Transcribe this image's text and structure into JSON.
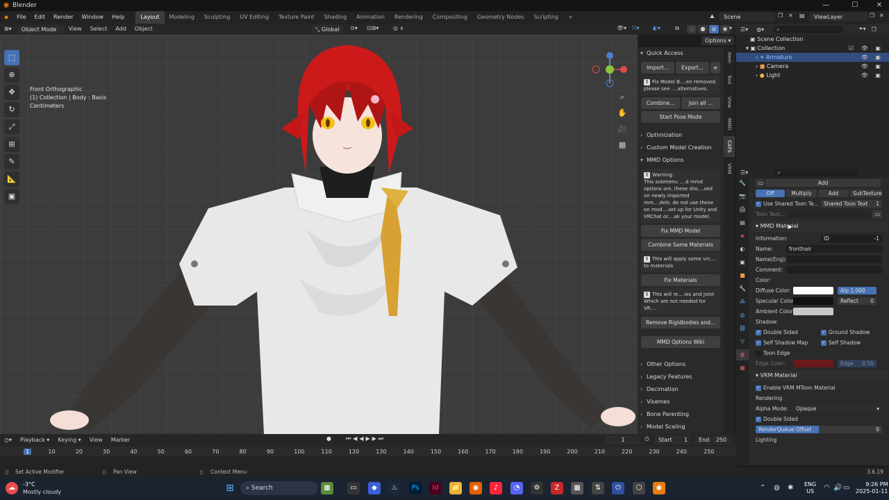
{
  "window": {
    "title": "Blender",
    "controls": [
      "—",
      "☐",
      "✕"
    ]
  },
  "menu": [
    "File",
    "Edit",
    "Render",
    "Window",
    "Help"
  ],
  "workspaces": [
    "Layout",
    "Modeling",
    "Sculpting",
    "UV Editing",
    "Texture Paint",
    "Shading",
    "Animation",
    "Rendering",
    "Compositing",
    "Geometry Nodes",
    "Scripting",
    "+"
  ],
  "scene": {
    "scene_name": "Scene",
    "view_layer": "ViewLayer"
  },
  "viewport_header": {
    "mode": "Object Mode",
    "menus": [
      "View",
      "Select",
      "Add",
      "Object"
    ],
    "orientation": "Global",
    "options_label": "Options"
  },
  "viewport": {
    "info_line1": "Front Orthographic",
    "info_line2": "(1) Collection | Body : Basis",
    "info_line3": "Centimeters"
  },
  "npanel": {
    "tabs": [
      "Item",
      "Tool",
      "View",
      "MMD",
      "CATS",
      "VRM"
    ],
    "quick_access": "Quick Access",
    "import_btn": "Import...",
    "export_btn": "Export...",
    "fix_notice": "Fix Model B....en removed. please see ....alternatives.",
    "combine_btn": "Combine...",
    "join_btn": "Join all ...",
    "pose_btn": "Start Pose Mode",
    "optimization": "Optimization",
    "custom_model": "Custom Model Creation",
    "mmd_options": "MMD Options",
    "warning_title": "Warning:",
    "warning_text": "This submenu ....d mmd options are, these sho....sed on newly imported mm....dels. do not use these on mod....set up for Unity and VRChat or....ak your model.",
    "fix_mmd_btn": "Fix MMD Model",
    "combine_mats_btn": "Combine Same Materials",
    "vrc_note": "This will apply some vrc.... to materials",
    "fix_mats_btn": "Fix Materials",
    "rigid_note": "This will re....ies and Joint Which are not needed for VR....",
    "remove_rigid_btn": "Remove Rigidbodies and...",
    "wiki_btn": "MMD Options Wiki",
    "other_options": "Other Options",
    "legacy": "Legacy Features",
    "decimation": "Decimation",
    "visemes": "Visemes",
    "bone_parenting": "Bone Parenting",
    "model_scaling": "Model Scaling"
  },
  "outliner": {
    "scene_collection": "Scene Collection",
    "collection": "Collection",
    "items": [
      {
        "name": "Armature",
        "selected": true
      },
      {
        "name": "Camera",
        "selected": false
      },
      {
        "name": "Light",
        "selected": false
      }
    ]
  },
  "properties": {
    "add_label": "Add",
    "blend_modes": [
      "Off",
      "Multiply",
      "Add",
      "SubTexture"
    ],
    "use_shared_toon": "Use Shared Toon Te...",
    "shared_toon_text": "Shared Toon Text",
    "shared_toon_value": "1",
    "toon_text": "Toon Text...",
    "mmd_material": "MMD Material",
    "information": "Information:",
    "id_label": "ID",
    "id_value": "-1",
    "name_label": "Name:",
    "name_value": "fronthair",
    "name_eng_label": "Name(Eng):",
    "comment_label": "Comment:",
    "color_label": "Color:",
    "diffuse_label": "Diffuse Color:",
    "alpha_label": "Alp",
    "alpha_value": "1.000",
    "specular_label": "Specular Color:",
    "reflect_label": "Reflect",
    "reflect_value": "0",
    "ambient_label": "Ambient Color:",
    "shadow_label": "Shadow:",
    "double_sided": "Double Sided",
    "ground_shadow": "Ground Shadow",
    "self_shadow_map": "Self Shadow Map",
    "self_shadow": "Self Shadow",
    "toon_edge": "Toon Edge",
    "edge_color": "Edge Color:",
    "edge_label": "Edge",
    "edge_value": "0.50",
    "vrm_material": "VRM Material",
    "enable_vrm": "Enable VRM MToon Material",
    "rendering": "Rendering",
    "alpha_mode_label": "Alpha Mode:",
    "alpha_mode_value": "Opaque",
    "double_sided_2": "Double Sided",
    "render_queue": "RenderQueue Offset",
    "render_queue_value": "0",
    "lighting": "Lighting",
    "colors": {
      "diffuse": "#ffffff",
      "specular": "#111111",
      "ambient": "#c8c8c8",
      "edge": "#6a1a1a"
    }
  },
  "timeline": {
    "menus": [
      "Playback",
      "Keying",
      "View",
      "Marker"
    ],
    "current_frame": "1",
    "start_label": "Start",
    "start_value": "1",
    "end_label": "End",
    "end_value": "250",
    "ticks": [
      "1",
      "10",
      "20",
      "30",
      "40",
      "50",
      "60",
      "70",
      "80",
      "90",
      "100",
      "110",
      "120",
      "130",
      "140",
      "150",
      "160",
      "170",
      "180",
      "190",
      "200",
      "210",
      "220",
      "230",
      "240",
      "250"
    ]
  },
  "statusbar": {
    "left": "Set Active Modifier",
    "middle": "Pan View",
    "right": "Context Menu",
    "version": "3.6.19"
  },
  "taskbar": {
    "temp": "-3°C",
    "weather": "Mostly cloudy",
    "search": "Search",
    "lang1": "ENG",
    "lang2": "US",
    "time": "9:26 PM",
    "date": "2025-01-11"
  },
  "accent": "#4772b3"
}
